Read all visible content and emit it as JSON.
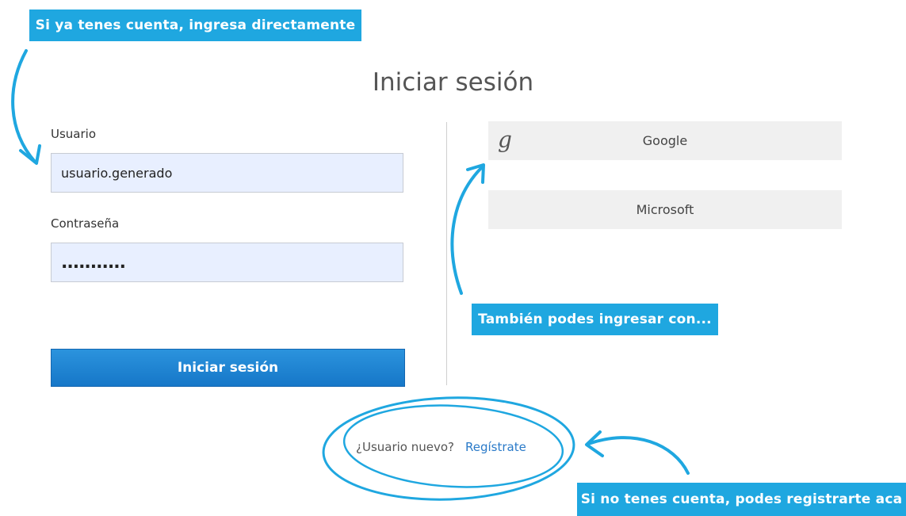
{
  "callouts": {
    "login_directly": "Si ya tenes cuenta, ingresa directamente",
    "also_login_with": "También podes ingresar con...",
    "register_here": "Si no tenes cuenta, podes registrarte aca"
  },
  "login": {
    "title": "Iniciar sesión",
    "username_label": "Usuario",
    "username_value": "usuario.generado",
    "password_label": "Contraseña",
    "password_value": "...........",
    "submit_label": "Iniciar sesión"
  },
  "social": {
    "google_label": "Google",
    "google_icon_glyph": "g",
    "microsoft_label": "Microsoft"
  },
  "register": {
    "prompt": "¿Usuario nuevo?",
    "link": "Regístrate"
  },
  "colors": {
    "accent": "#1fa7e0",
    "button": "#1a84d3",
    "link": "#2a7ac8"
  }
}
